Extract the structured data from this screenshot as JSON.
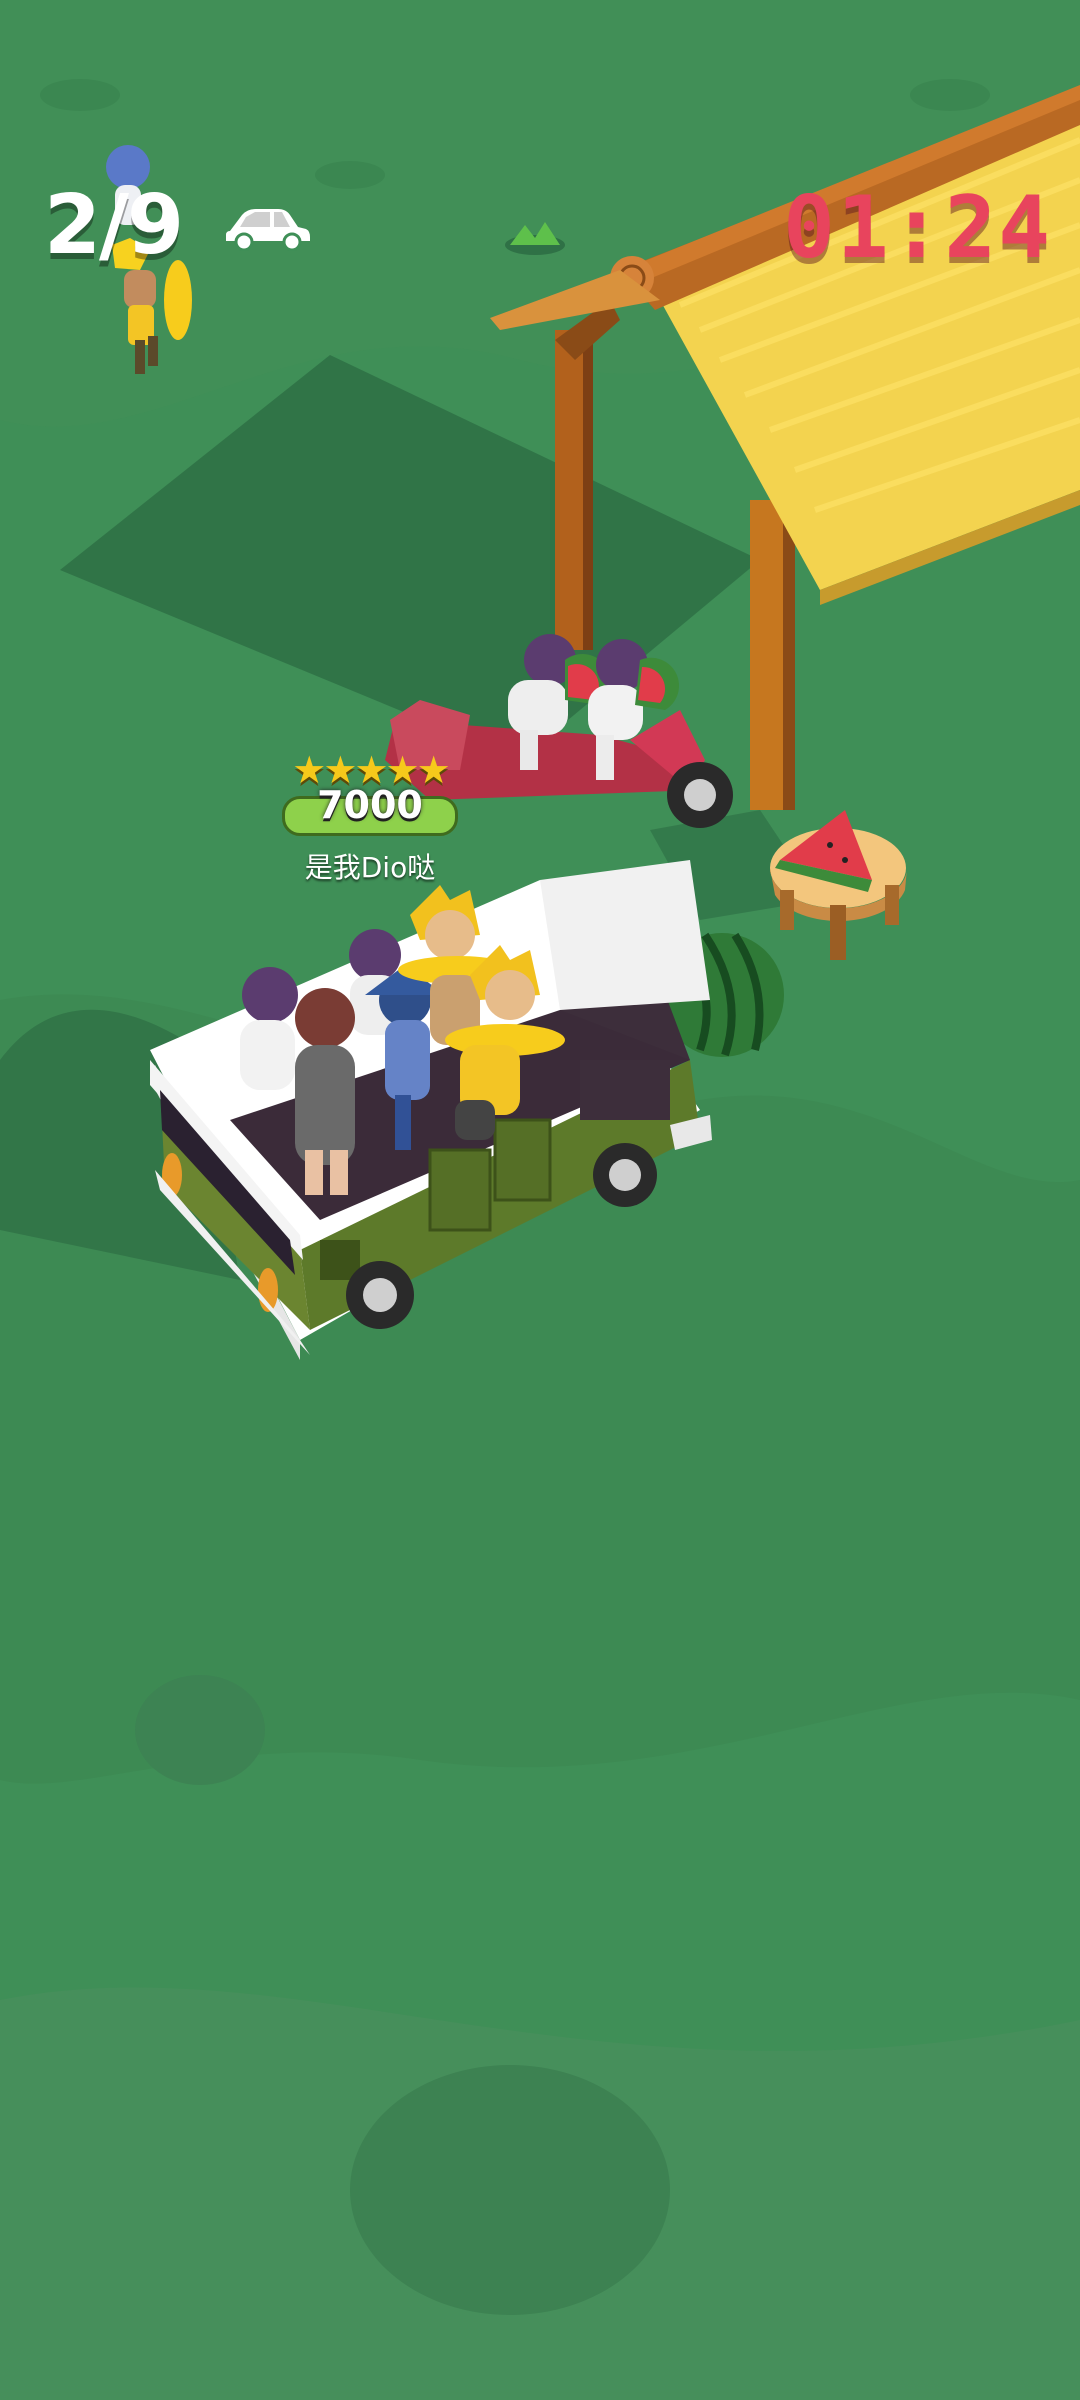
{
  "hud": {
    "passenger_count": "2/9",
    "vehicle_icon": "car-icon",
    "timer": "01:24"
  },
  "player_tag": {
    "stars": 5,
    "score": "7000",
    "name": "是我Dio哒"
  },
  "colors": {
    "ground": "#3f8f57",
    "timer": "#e8445d",
    "van_green": "#5d7a2a",
    "roof_yellow": "#f3d34f",
    "wood": "#b7691c",
    "scooter_red": "#c2314b"
  }
}
